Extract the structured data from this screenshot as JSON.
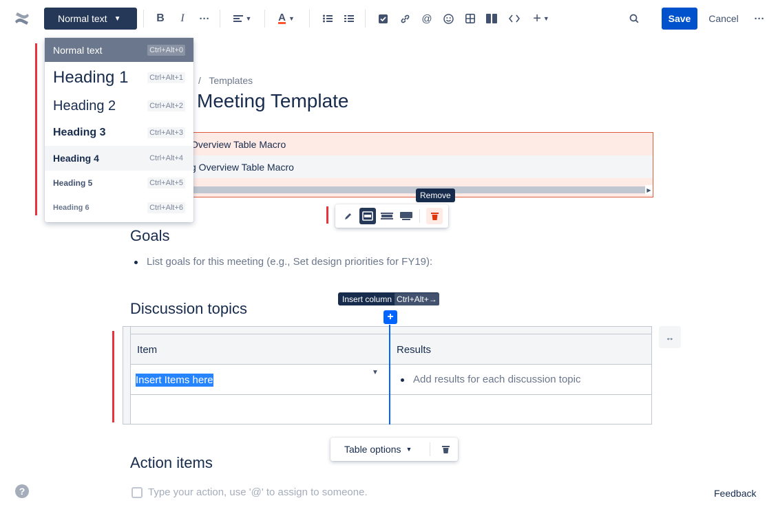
{
  "toolbar": {
    "text_style": "Normal text",
    "save": "Save",
    "cancel": "Cancel",
    "icons": [
      "confluence-logo",
      "bold",
      "italic",
      "more-formatting",
      "alignment",
      "text-color",
      "bullet-list",
      "numbered-list",
      "action-item",
      "link",
      "mention",
      "emoji",
      "table",
      "layouts",
      "code",
      "insert",
      "search",
      "more"
    ]
  },
  "style_menu": {
    "items": [
      {
        "label": "Normal text",
        "shortcut": "Ctrl+Alt+0"
      },
      {
        "label": "Heading 1",
        "shortcut": "Ctrl+Alt+1"
      },
      {
        "label": "Heading 2",
        "shortcut": "Ctrl+Alt+2"
      },
      {
        "label": "Heading 3",
        "shortcut": "Ctrl+Alt+3"
      },
      {
        "label": "Heading 4",
        "shortcut": "Ctrl+Alt+4"
      },
      {
        "label": "Heading 5",
        "shortcut": "Ctrl+Alt+5"
      },
      {
        "label": "Heading 6",
        "shortcut": "Ctrl+Alt+6"
      }
    ]
  },
  "page": {
    "breadcrumb_sep": "/",
    "breadcrumb": "Templates",
    "title": "Meeting Template",
    "macro_rows": [
      "Overview Table Macro",
      "g Overview Table Macro"
    ],
    "remove_tooltip": "Remove",
    "goals_heading": "Goals",
    "goals_item": "List goals for this meeting (e.g., Set design priorities for FY19):",
    "discussion_heading": "Discussion topics",
    "insert_column_label": "Insert column",
    "insert_column_shortcut": "Ctrl+Alt+→",
    "table": {
      "headers": [
        "Item",
        "Results"
      ],
      "row1_item": "Insert Items here",
      "row1_result": "Add results for each discussion topic"
    },
    "table_options": "Table options",
    "action_heading": "Action items",
    "action_placeholder": "Type your action, use '@' to assign to someone."
  },
  "feedback": "Feedback",
  "colors": {
    "primary": "#0052CC",
    "dark": "#253858",
    "warning_border": "#DE5B3B",
    "red_marker": "#E5343A"
  }
}
